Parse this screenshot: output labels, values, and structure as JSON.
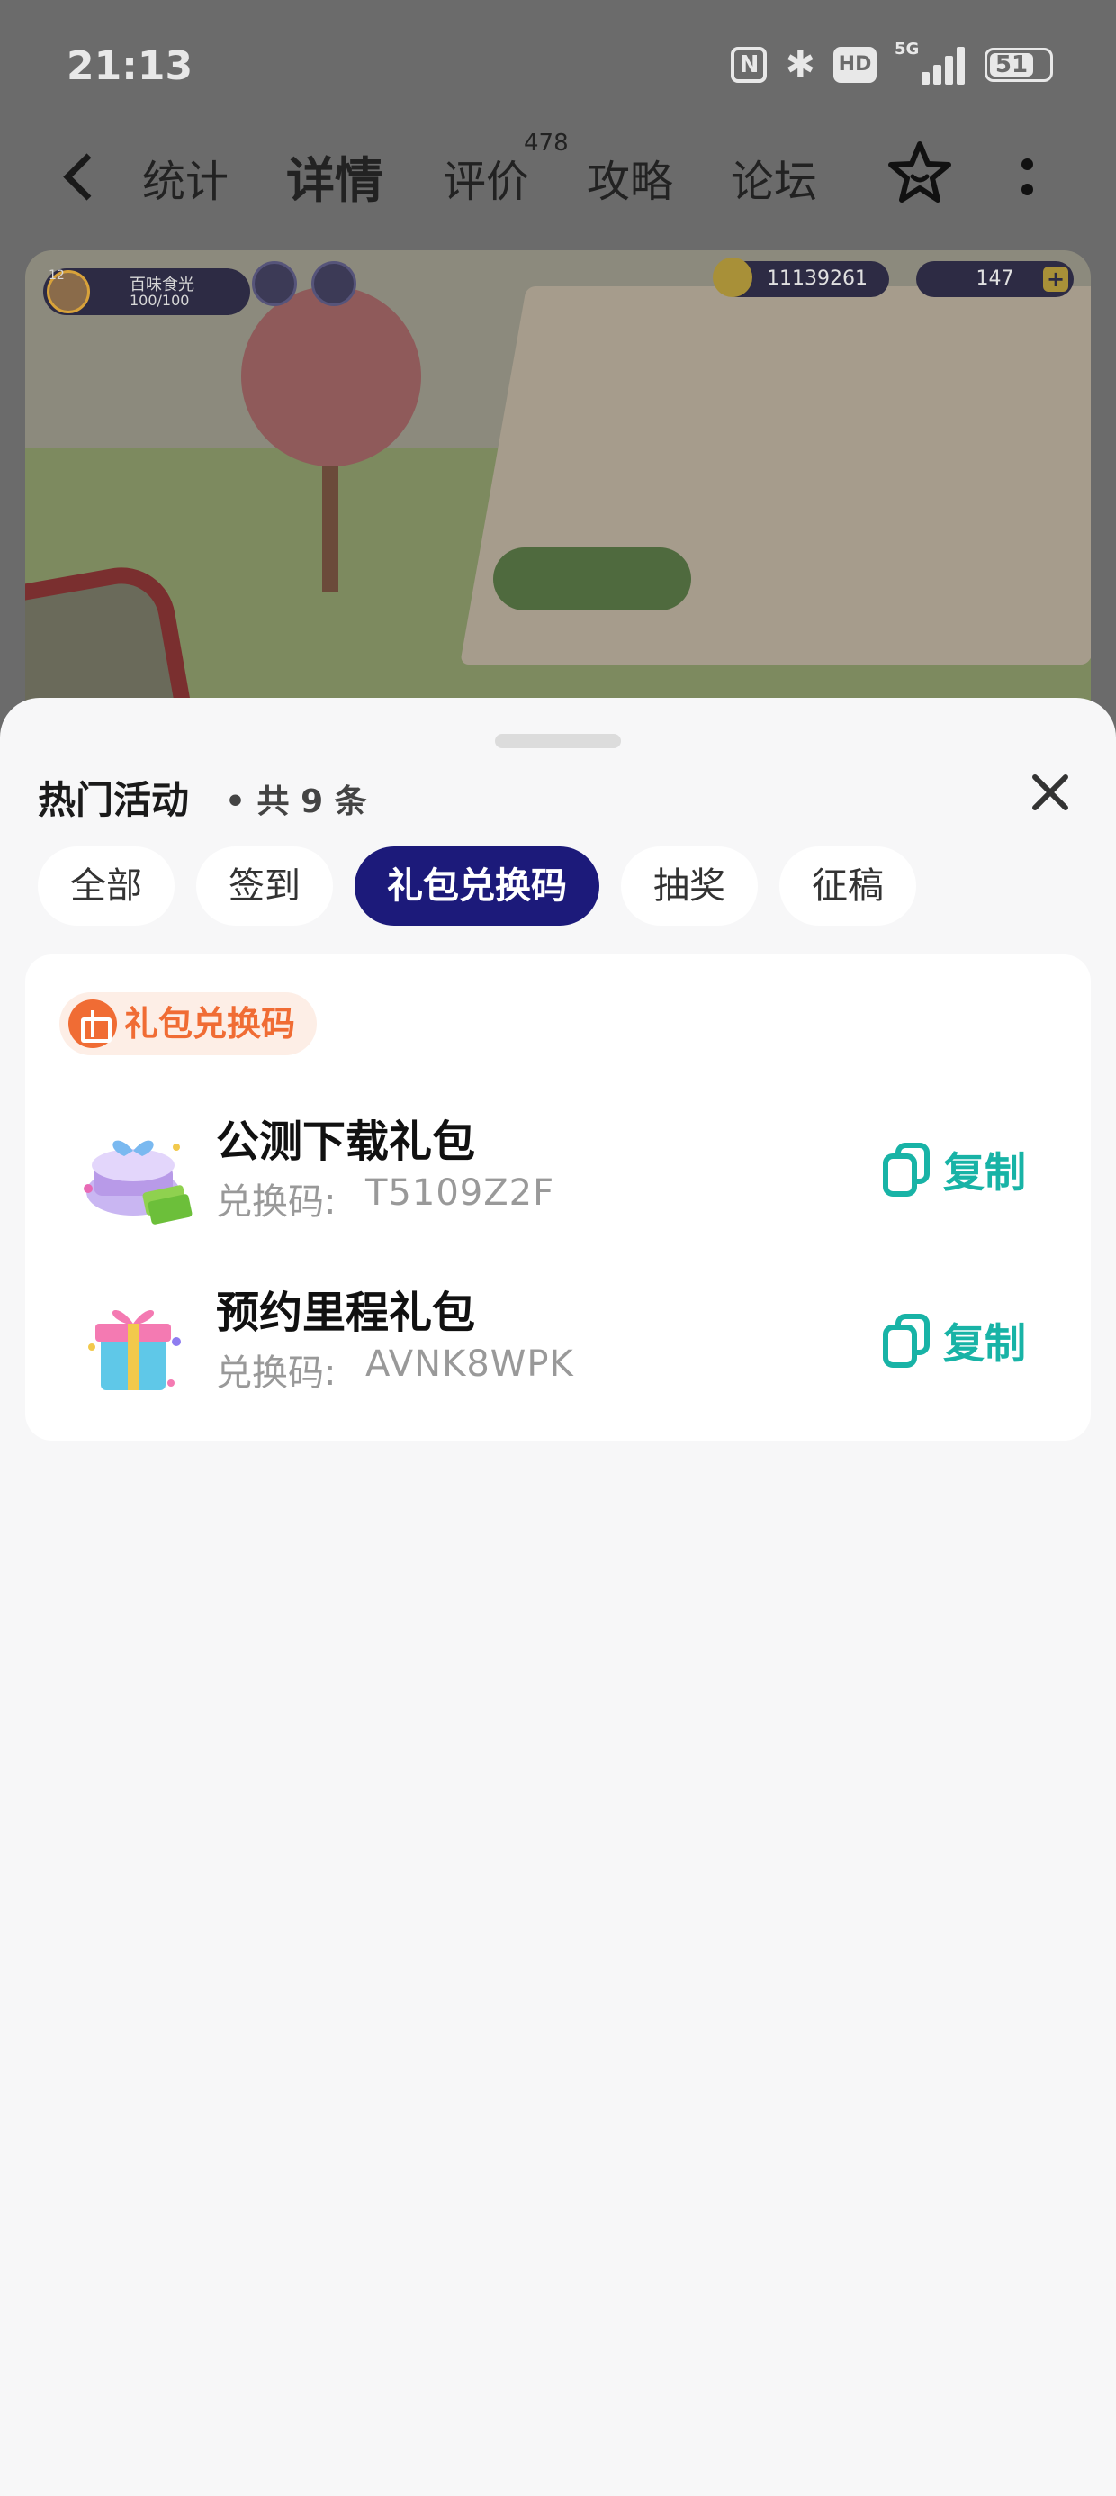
{
  "status_bar": {
    "time": "21:13",
    "network_tag": "5G",
    "hd_label": "HD",
    "nfc_label": "N",
    "battery_level": "51",
    "icons": [
      "nfc-icon",
      "bluetooth-icon",
      "hd-icon",
      "signal-icon",
      "battery-icon"
    ]
  },
  "nav": {
    "tabs": [
      {
        "label": "统计",
        "active": false
      },
      {
        "label": "详情",
        "active": true
      },
      {
        "label": "评价",
        "active": false,
        "badge": "478"
      },
      {
        "label": "攻略",
        "active": false
      },
      {
        "label": "论坛",
        "active": false
      }
    ],
    "icons": [
      "back-icon",
      "star-icon",
      "more-icon"
    ],
    "accent": "#0f7a68"
  },
  "hero": {
    "player_name": "百味食光",
    "player_level": "12",
    "energy": "100/100",
    "coins": "11139261",
    "cash": "147"
  },
  "sheet": {
    "title": "热门活动",
    "count_text": "• 共 9 条",
    "filters": [
      {
        "label": "全部",
        "active": false
      },
      {
        "label": "签到",
        "active": false
      },
      {
        "label": "礼包兑换码",
        "active": true
      },
      {
        "label": "抽奖",
        "active": false
      },
      {
        "label": "征稿",
        "active": false
      }
    ],
    "active_chip_color": "#1c1a7a",
    "card": {
      "tag_label": "礼包兑换码",
      "tag_color": "#f06c34",
      "gifts": [
        {
          "name": "公测下载礼包",
          "code_label": "兑换码:",
          "code": "T5109Z2F",
          "copy_label": "复制"
        },
        {
          "name": "预约里程礼包",
          "code_label": "兑换码:",
          "code": "AVNK8WPK",
          "copy_label": "复制"
        }
      ],
      "copy_color": "#18b3a6"
    }
  }
}
